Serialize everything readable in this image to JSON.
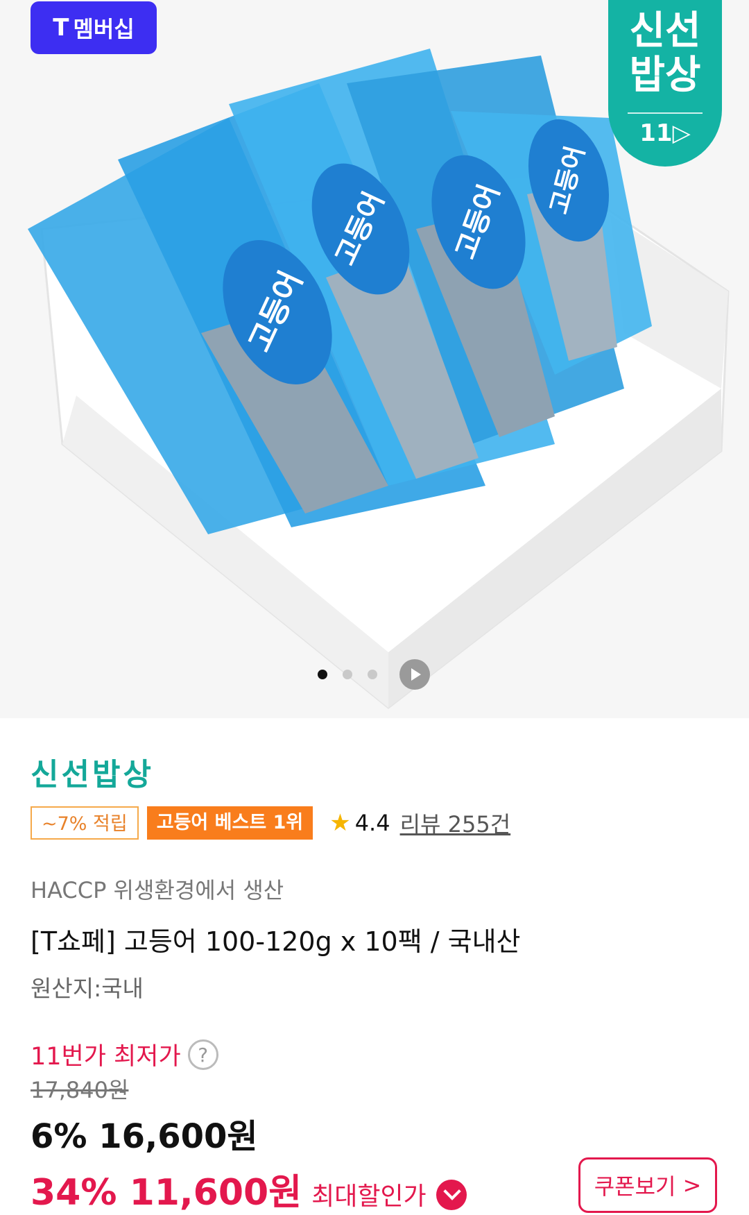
{
  "badges": {
    "membership": "멤버십",
    "membership_logo": "T",
    "brand_line1": "신선",
    "brand_line2": "밥상",
    "brand_logo": "11▷"
  },
  "product_image": {
    "package_text": "고등어",
    "carousel_total": 3,
    "carousel_active": 1
  },
  "store_name": "신선밥상",
  "tags": {
    "point": "~7% 적립",
    "best": "고등어 베스트 1위"
  },
  "rating": {
    "score": "4.4",
    "reviews": "리뷰 255건"
  },
  "haccp": "HACCP 위생환경에서 생산",
  "title": "[T쇼페] 고등어 100-120g x 10팩 / 국내산",
  "origin": "원산지:국내",
  "pricing": {
    "lowest_label": "11번가 최저가",
    "help": "?",
    "original_price": "17,840원",
    "sale": "6% 16,600원",
    "max_discount": "34% 11,600원",
    "max_discount_label": "최대할인가",
    "coupon_button": "쿠폰보기",
    "coupon_chevron": ">"
  },
  "colors": {
    "membership_bg": "#3d2ef2",
    "brand_teal": "#14b3a4",
    "accent_red": "#e3184d",
    "best_orange": "#f97d1c"
  }
}
